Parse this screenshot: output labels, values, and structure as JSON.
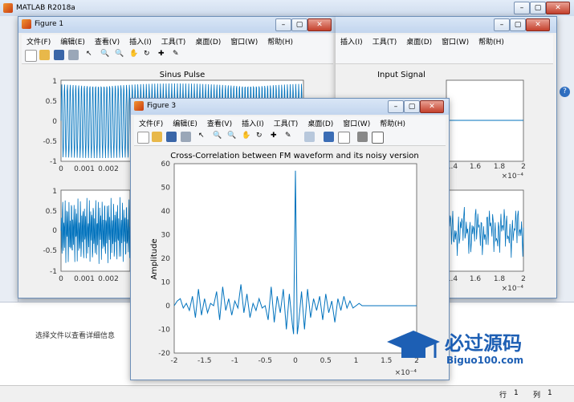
{
  "app": {
    "title": "MATLAB R2018a"
  },
  "figure1": {
    "title": "Figure 1",
    "menus": [
      "文件(F)",
      "编辑(E)",
      "查看(V)",
      "插入(I)",
      "工具(T)",
      "桌面(D)",
      "窗口(W)",
      "帮助(H)"
    ],
    "plot_top_title": "Sinus Pulse",
    "right_plot_title": "Input Signal",
    "y_ticks_top": [
      "1",
      "0.5",
      "0",
      "-0.5",
      "-1"
    ],
    "x_ticks_top": [
      "0",
      "0.001",
      "0.002"
    ],
    "y_ticks_bottom": [
      "1",
      "0.5",
      "0",
      "-0.5",
      "-1"
    ],
    "x_ticks_bottom": [
      "0",
      "0.001",
      "0.002"
    ],
    "right_x_ticks": [
      "1.4",
      "1.6",
      "1.8",
      "2"
    ],
    "right_x_ticks_bottom": [
      "1.4",
      "1.6",
      "1.8",
      "2"
    ],
    "exp_label": "×10⁻⁴",
    "partial_menus": [
      "插入(I)",
      "工具(T)",
      "桌面(D)",
      "窗口(W)",
      "帮助(H)"
    ]
  },
  "figure3": {
    "title": "Figure 3",
    "menus": [
      "文件(F)",
      "编辑(E)",
      "查看(V)",
      "插入(I)",
      "工具(T)",
      "桌面(D)",
      "窗口(W)",
      "帮助(H)"
    ],
    "exp_label": "×10⁻⁴"
  },
  "chart_data": {
    "type": "line",
    "title": "Cross-Correlation between FM waveform and its noisy version",
    "xlabel": "",
    "ylabel": "Amplitude",
    "x_multiplier": "×10^-4",
    "xlim": [
      -2,
      2
    ],
    "ylim": [
      -20,
      60
    ],
    "x_ticks": [
      -2,
      -1.5,
      -1,
      -0.5,
      0,
      0.5,
      1,
      1.5,
      2
    ],
    "y_ticks": [
      -20,
      -10,
      0,
      10,
      20,
      30,
      40,
      50,
      60
    ],
    "series": [
      {
        "x": [
          -2,
          -1.95,
          -1.9,
          -1.85,
          -1.8,
          -1.75,
          -1.7,
          -1.65,
          -1.6,
          -1.55,
          -1.5,
          -1.45,
          -1.4,
          -1.35,
          -1.3,
          -1.25,
          -1.2,
          -1.15,
          -1.1,
          -1.05,
          -1,
          -0.95,
          -0.9,
          -0.85,
          -0.8,
          -0.75,
          -0.7,
          -0.65,
          -0.6,
          -0.55,
          -0.5,
          -0.45,
          -0.4,
          -0.35,
          -0.3,
          -0.25,
          -0.2,
          -0.15,
          -0.1,
          -0.05,
          -0.03,
          0,
          0.03,
          0.05,
          0.1,
          0.15,
          0.2,
          0.25,
          0.3,
          0.35,
          0.4,
          0.45,
          0.5,
          0.55,
          0.6,
          0.65,
          0.7,
          0.75,
          0.8,
          0.85,
          0.9,
          0.95,
          1,
          1.05,
          1.1,
          1.2,
          1.4,
          1.6,
          1.8,
          2
        ],
        "y": [
          0,
          2,
          3,
          -1,
          1,
          -2,
          4,
          -5,
          7,
          -4,
          3,
          -3,
          1,
          0,
          6,
          -6,
          8,
          -2,
          3,
          -4,
          2,
          -1,
          9,
          -3,
          5,
          -5,
          1,
          -2,
          3,
          -1,
          0,
          -6,
          8,
          -7,
          4,
          -3,
          7,
          -10,
          5,
          -8,
          -12,
          57,
          -12,
          -8,
          6,
          -10,
          7,
          -5,
          3,
          -2,
          4,
          -6,
          5,
          -3,
          2,
          -7,
          3,
          -2,
          4,
          -1,
          2,
          -1,
          0,
          1,
          0,
          0,
          0,
          0,
          0,
          0
        ]
      }
    ]
  },
  "desktop": {
    "file_hint": "选择文件以查看详细信息",
    "status_row_label": "行",
    "status_row_value": "1",
    "status_col_label": "列",
    "status_col_value": "1",
    "watermark_cn": "必过源码",
    "watermark_url": "Biguo100.com"
  }
}
